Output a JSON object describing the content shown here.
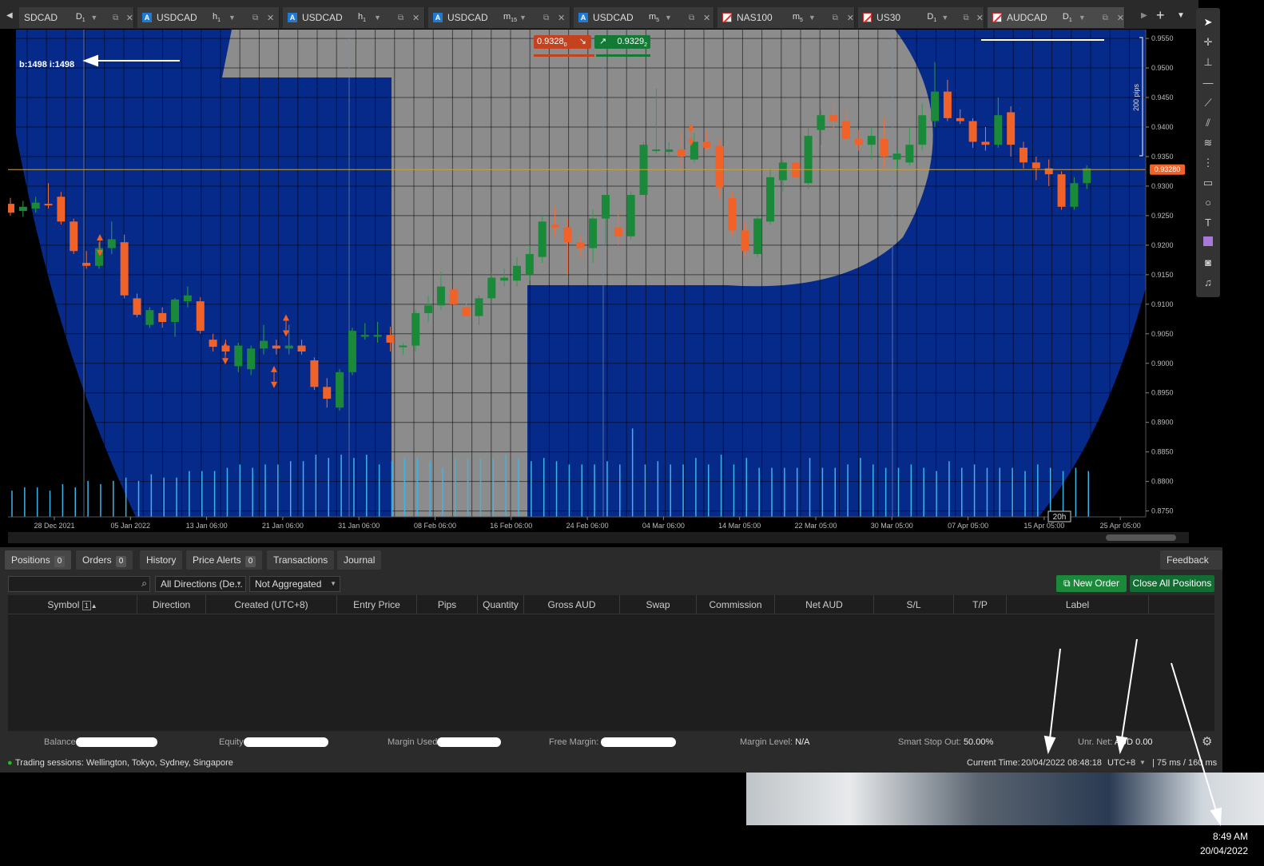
{
  "tabs": [
    {
      "symbol": "SDCAD",
      "tf": "D",
      "sub": "1",
      "icon": "a",
      "active": false
    },
    {
      "symbol": "USDCAD",
      "tf": "h",
      "sub": "1",
      "icon": "a",
      "active": false
    },
    {
      "symbol": "USDCAD",
      "tf": "h",
      "sub": "1",
      "icon": "a",
      "active": false
    },
    {
      "symbol": "USDCAD",
      "tf": "m",
      "sub": "15",
      "icon": "a",
      "active": false
    },
    {
      "symbol": "USDCAD",
      "tf": "m",
      "sub": "5",
      "icon": "a",
      "active": false
    },
    {
      "symbol": "NAS100",
      "tf": "m",
      "sub": "5",
      "icon": "flag",
      "active": false
    },
    {
      "symbol": "US30",
      "tf": "D",
      "sub": "1",
      "icon": "flag",
      "active": false
    },
    {
      "symbol": "AUDCAD",
      "tf": "D",
      "sub": "1",
      "icon": "flag",
      "active": true
    }
  ],
  "chart": {
    "bar_info": "b:1498 i:1498",
    "sell_price": "0.9328",
    "sell_sup": "0",
    "buy_price": "0.9329",
    "buy_sup": "2",
    "current_price_label": "0.93280",
    "current_price": 0.9328,
    "pips_label": "200 pips",
    "countdown": "20h",
    "price_axis": [
      "0.9550",
      "0.9500",
      "0.9450",
      "0.9400",
      "0.9350",
      "0.9300",
      "0.9250",
      "0.9200",
      "0.9150",
      "0.9100",
      "0.9050",
      "0.9000",
      "0.8950",
      "0.8900",
      "0.8850",
      "0.8800",
      "0.8750"
    ],
    "time_axis": [
      "28 Dec 2021",
      "05 Jan 2022",
      "13 Jan 06:00",
      "21 Jan 06:00",
      "31 Jan 06:00",
      "08 Feb 06:00",
      "16 Feb 06:00",
      "24 Feb 06:00",
      "04 Mar 06:00",
      "14 Mar 05:00",
      "22 Mar 05:00",
      "30 Mar 05:00",
      "07 Apr 05:00",
      "15 Apr 05:00",
      "25 Apr 05:00"
    ],
    "colors": {
      "up": "#1a8a3a",
      "down": "#f06228",
      "bg_blue": "#062a8a",
      "bg_gray": "#8c8c8c",
      "volume": "#3db4e8",
      "price_line": "#c8a23c"
    }
  },
  "chart_data": {
    "type": "candlestick",
    "symbol": "AUDCAD",
    "timeframe": "D1",
    "ylim": [
      0.874,
      0.9565
    ],
    "ohlc": [
      [
        0.927,
        0.928,
        0.925,
        0.9255
      ],
      [
        0.9258,
        0.9275,
        0.9248,
        0.9265
      ],
      [
        0.9262,
        0.9282,
        0.9255,
        0.9272
      ],
      [
        0.927,
        0.9305,
        0.9262,
        0.9268
      ],
      [
        0.9282,
        0.929,
        0.9235,
        0.924
      ],
      [
        0.924,
        0.9245,
        0.9185,
        0.919
      ],
      [
        0.917,
        0.919,
        0.916,
        0.9165
      ],
      [
        0.9165,
        0.9205,
        0.916,
        0.9195
      ],
      [
        0.9195,
        0.924,
        0.9185,
        0.921
      ],
      [
        0.9205,
        0.9218,
        0.911,
        0.9115
      ],
      [
        0.911,
        0.9118,
        0.9078,
        0.9082
      ],
      [
        0.9065,
        0.9095,
        0.906,
        0.909
      ],
      [
        0.9085,
        0.9095,
        0.906,
        0.907
      ],
      [
        0.907,
        0.911,
        0.9045,
        0.9108
      ],
      [
        0.9105,
        0.913,
        0.9095,
        0.9115
      ],
      [
        0.9105,
        0.9112,
        0.905,
        0.9055
      ],
      [
        0.904,
        0.905,
        0.902,
        0.9028
      ],
      [
        0.903,
        0.904,
        0.9015,
        0.902
      ],
      [
        0.8995,
        0.9035,
        0.8985,
        0.903
      ],
      [
        0.899,
        0.903,
        0.898,
        0.9025
      ],
      [
        0.9025,
        0.9065,
        0.9015,
        0.9038
      ],
      [
        0.903,
        0.904,
        0.9015,
        0.9025
      ],
      [
        0.9025,
        0.9065,
        0.9015,
        0.903
      ],
      [
        0.903,
        0.904,
        0.9015,
        0.902
      ],
      [
        0.9005,
        0.901,
        0.8955,
        0.896
      ],
      [
        0.896,
        0.8975,
        0.8925,
        0.894
      ],
      [
        0.8925,
        0.899,
        0.892,
        0.8985
      ],
      [
        0.8985,
        0.906,
        0.898,
        0.9055
      ],
      [
        0.9045,
        0.9068,
        0.904,
        0.9048
      ],
      [
        0.9045,
        0.907,
        0.9035,
        0.9048
      ],
      [
        0.9048,
        0.9062,
        0.902,
        0.9035
      ],
      [
        0.903,
        0.9035,
        0.9015,
        0.903
      ],
      [
        0.903,
        0.909,
        0.902,
        0.9085
      ],
      [
        0.9085,
        0.9115,
        0.907,
        0.9098
      ],
      [
        0.9098,
        0.9155,
        0.909,
        0.913
      ],
      [
        0.9125,
        0.9135,
        0.9095,
        0.91
      ],
      [
        0.9095,
        0.9105,
        0.907,
        0.908
      ],
      [
        0.908,
        0.9115,
        0.9065,
        0.911
      ],
      [
        0.911,
        0.9155,
        0.91,
        0.9145
      ],
      [
        0.914,
        0.916,
        0.913,
        0.9145
      ],
      [
        0.914,
        0.918,
        0.913,
        0.9165
      ],
      [
        0.915,
        0.92,
        0.914,
        0.9185
      ],
      [
        0.918,
        0.925,
        0.917,
        0.924
      ],
      [
        0.9235,
        0.9265,
        0.9215,
        0.923
      ],
      [
        0.923,
        0.9245,
        0.915,
        0.9205
      ],
      [
        0.9205,
        0.9215,
        0.918,
        0.9195
      ],
      [
        0.9195,
        0.926,
        0.917,
        0.9245
      ],
      [
        0.9245,
        0.928,
        0.92,
        0.9285
      ],
      [
        0.923,
        0.9255,
        0.92,
        0.9215
      ],
      [
        0.9215,
        0.929,
        0.921,
        0.9285
      ],
      [
        0.9285,
        0.9375,
        0.9285,
        0.937
      ],
      [
        0.9362,
        0.9465,
        0.9355,
        0.9362
      ],
      [
        0.9358,
        0.9375,
        0.935,
        0.9362
      ],
      [
        0.9362,
        0.9395,
        0.9325,
        0.935
      ],
      [
        0.9345,
        0.939,
        0.934,
        0.9375
      ],
      [
        0.9375,
        0.9395,
        0.936,
        0.9365
      ],
      [
        0.9368,
        0.938,
        0.928,
        0.9298
      ],
      [
        0.928,
        0.929,
        0.9215,
        0.9225
      ],
      [
        0.9225,
        0.924,
        0.918,
        0.919
      ],
      [
        0.9185,
        0.925,
        0.918,
        0.9245
      ],
      [
        0.924,
        0.933,
        0.9235,
        0.9315
      ],
      [
        0.931,
        0.9345,
        0.929,
        0.934
      ],
      [
        0.934,
        0.9345,
        0.931,
        0.9315
      ],
      [
        0.9305,
        0.94,
        0.9295,
        0.9385
      ],
      [
        0.9395,
        0.943,
        0.937,
        0.942
      ],
      [
        0.942,
        0.944,
        0.9395,
        0.941
      ],
      [
        0.941,
        0.943,
        0.9375,
        0.938
      ],
      [
        0.938,
        0.9395,
        0.936,
        0.937
      ],
      [
        0.937,
        0.94,
        0.9345,
        0.9385
      ],
      [
        0.938,
        0.9415,
        0.933,
        0.935
      ],
      [
        0.9345,
        0.936,
        0.933,
        0.9355
      ],
      [
        0.934,
        0.94,
        0.9335,
        0.937
      ],
      [
        0.937,
        0.944,
        0.936,
        0.942
      ],
      [
        0.941,
        0.951,
        0.94,
        0.946
      ],
      [
        0.946,
        0.948,
        0.941,
        0.9415
      ],
      [
        0.9415,
        0.943,
        0.9405,
        0.941
      ],
      [
        0.941,
        0.9415,
        0.9365,
        0.9375
      ],
      [
        0.9375,
        0.94,
        0.936,
        0.937
      ],
      [
        0.937,
        0.945,
        0.9365,
        0.942
      ],
      [
        0.9425,
        0.9435,
        0.935,
        0.937
      ],
      [
        0.9365,
        0.9375,
        0.933,
        0.934
      ],
      [
        0.934,
        0.935,
        0.931,
        0.933
      ],
      [
        0.933,
        0.9345,
        0.93,
        0.932
      ],
      [
        0.932,
        0.9325,
        0.926,
        0.9265
      ],
      [
        0.9265,
        0.9315,
        0.926,
        0.9305
      ],
      [
        0.9305,
        0.9335,
        0.9295,
        0.933
      ]
    ],
    "volume": [
      8,
      9,
      9,
      8,
      10,
      9,
      11,
      10,
      11,
      12,
      11,
      13,
      12,
      12,
      14,
      14,
      14,
      15,
      16,
      15,
      16,
      16,
      17,
      17,
      19,
      18,
      19,
      18,
      19,
      16,
      17,
      18,
      18,
      17,
      15,
      18,
      18,
      18,
      18,
      19,
      18,
      17,
      18,
      17,
      16,
      16,
      16,
      17,
      16,
      27,
      16,
      17,
      16,
      16,
      18,
      16,
      19,
      16,
      18,
      15,
      15,
      15,
      15,
      18,
      15,
      15,
      16,
      18,
      16,
      15,
      15,
      16,
      15,
      14,
      17,
      15,
      16,
      15,
      15,
      15,
      14,
      16,
      15,
      14,
      15,
      14
    ]
  },
  "panel": {
    "tabs": [
      {
        "label": "Positions",
        "count": "0"
      },
      {
        "label": "Orders",
        "count": "0"
      },
      {
        "label": "History",
        "count": ""
      },
      {
        "label": "Price Alerts",
        "count": "0"
      },
      {
        "label": "Transactions",
        "count": ""
      },
      {
        "label": "Journal",
        "count": ""
      }
    ],
    "feedback": "Feedback",
    "direction_filter": "All Directions (De...",
    "aggregation": "Not Aggregated",
    "new_order": "New Order",
    "close_all": "Close All Positions",
    "columns": [
      "Symbol",
      "Direction",
      "Created (UTC+8)",
      "Entry Price",
      "Pips",
      "Quantity",
      "Gross AUD",
      "Swap",
      "Commission",
      "Net AUD",
      "S/L",
      "T/P",
      "Label"
    ],
    "sort_badge": "1",
    "summary": {
      "balance": "Balance",
      "equity": "Equity",
      "margin_used": "Margin Used",
      "free_margin": "Free Margin",
      "margin_level_label": "Margin Level:",
      "margin_level": "N/A",
      "smart_stop_label": "Smart Stop Out:",
      "smart_stop": "50.00%",
      "unr_net_label": "Unr. Net:",
      "unr_net": "AUD 0.00"
    }
  },
  "status": {
    "sessions": "Trading sessions: Wellington, Tokyo, Sydney, Singapore",
    "current_time_label": "Current Time:",
    "current_time": "20/04/2022 08:48:18",
    "timezone": "UTC+8",
    "latency": "| 75 ms / 160 ms"
  },
  "taskbar": {
    "time": "8:49 AM",
    "date": "20/04/2022"
  }
}
